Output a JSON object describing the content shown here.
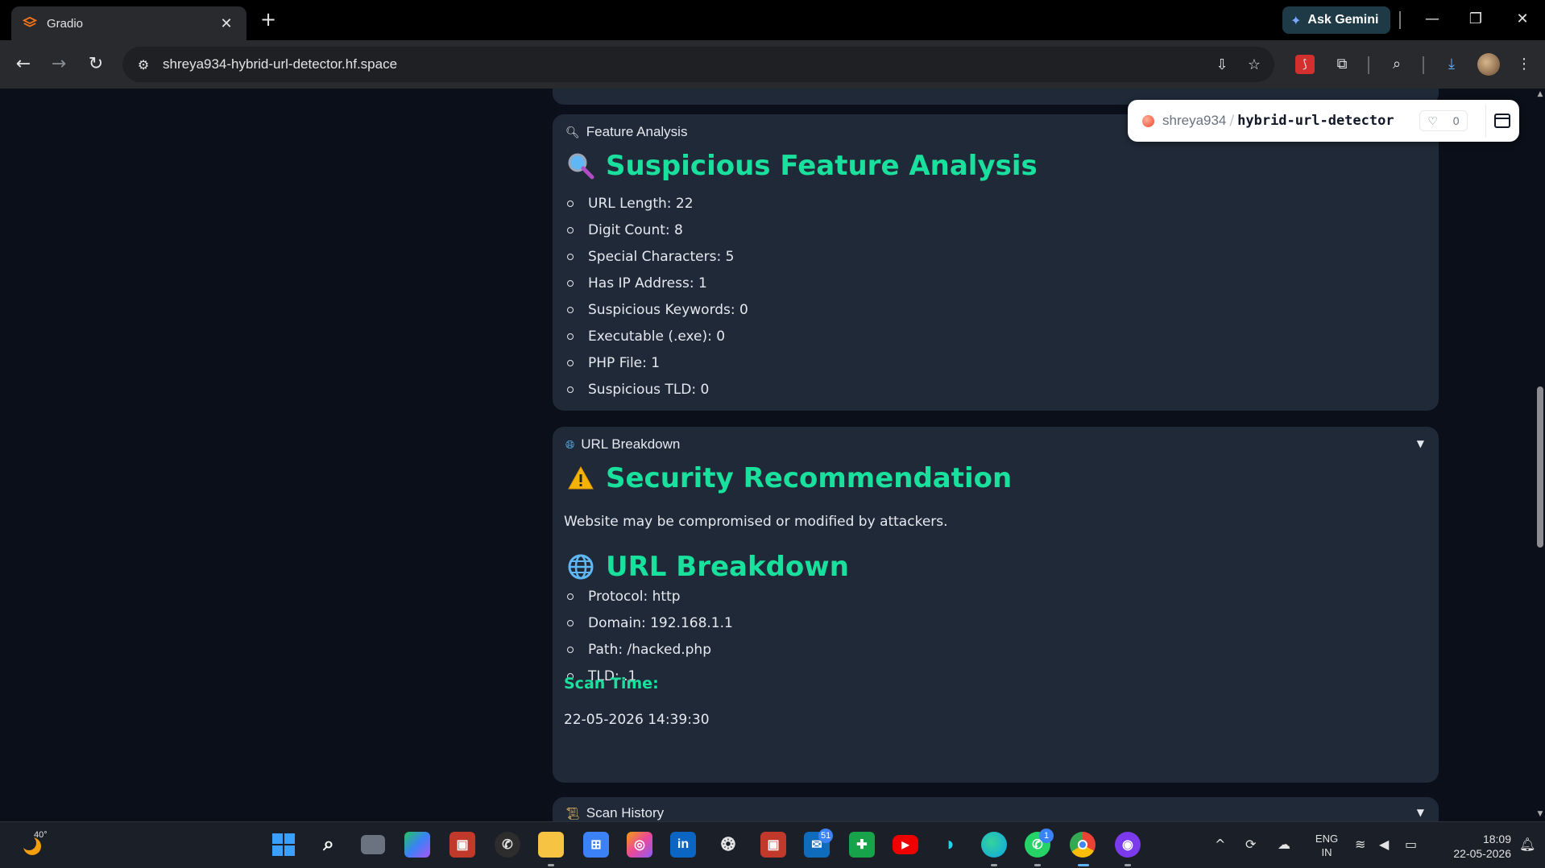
{
  "browser": {
    "tab_title": "Gradio",
    "url": "shreya934-hybrid-url-detector.hf.space",
    "gemini_label": "Ask Gemini"
  },
  "hf_badge": {
    "user": "shreya934",
    "repo": "hybrid-url-detector",
    "likes": "0"
  },
  "feature_card": {
    "label": "Feature Analysis",
    "heading": "Suspicious Feature Analysis",
    "items": [
      "URL Length: 22",
      "Digit Count: 8",
      "Special Characters: 5",
      "Has IP Address: 1",
      "Suspicious Keywords: 0",
      "Executable (.exe): 0",
      "PHP File: 1",
      "Suspicious TLD: 0"
    ]
  },
  "breakdown_card": {
    "label": "URL Breakdown",
    "recommendation_heading": "Security Recommendation",
    "recommendation_text": "Website may be compromised or modified by attackers.",
    "breakdown_heading": "URL Breakdown",
    "items": [
      "Protocol: http",
      "Domain: 192.168.1.1",
      "Path: /hacked.php",
      "TLD: .1"
    ],
    "scan_time_label": "Scan Time:",
    "scan_time_value": "22-05-2026 14:39:30"
  },
  "history_card": {
    "label": "Scan History"
  },
  "taskbar": {
    "temperature": "40°",
    "outlook_badge": "51",
    "whatsapp_badge": "1",
    "language": "ENG",
    "region": "IN",
    "time": "18:09",
    "date": "22-05-2026"
  },
  "colors": {
    "accent": "#19e19d",
    "card_bg": "#1f2937",
    "page_bg": "#0b0f19"
  }
}
